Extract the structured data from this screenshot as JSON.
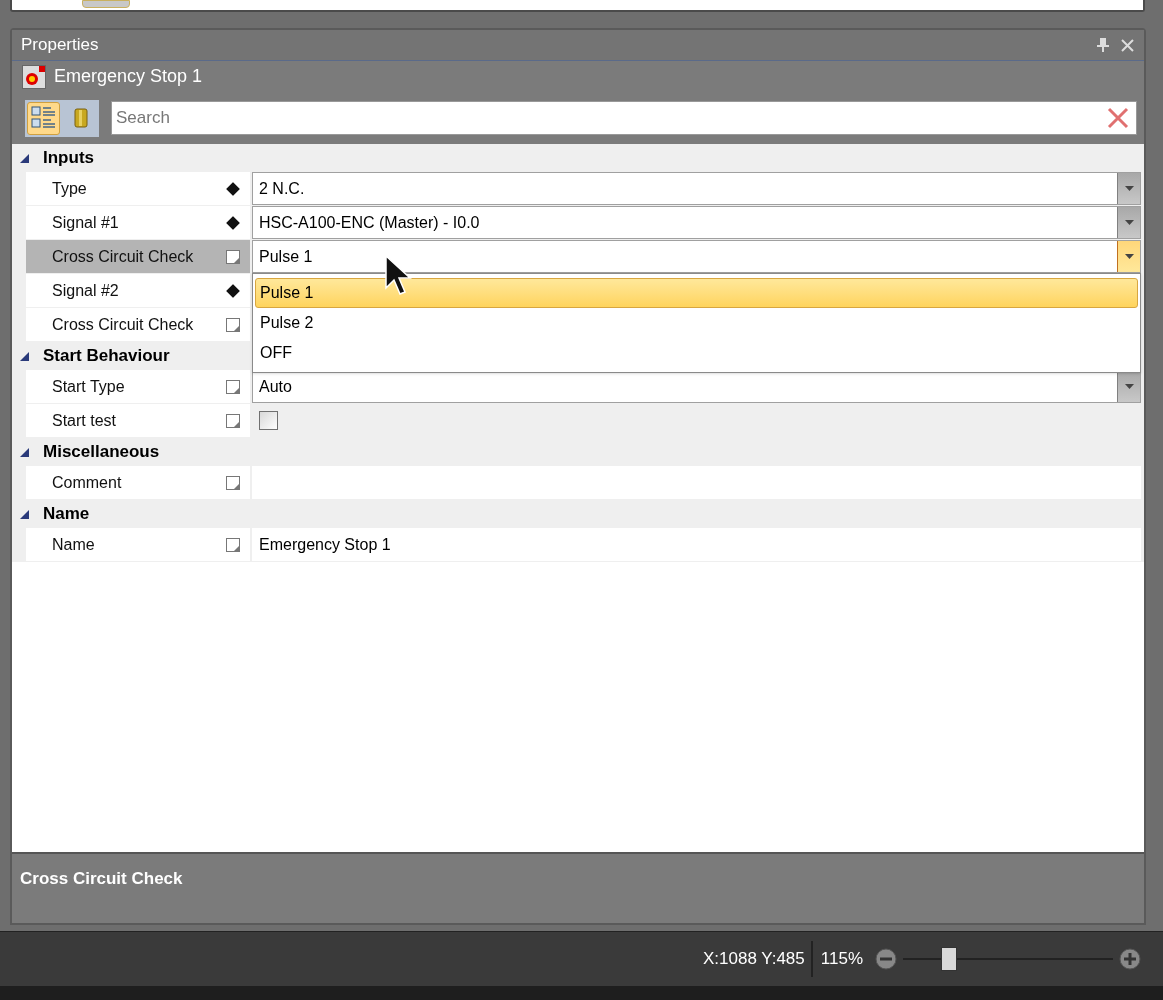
{
  "panel": {
    "title": "Properties"
  },
  "object": {
    "name": "Emergency Stop 1"
  },
  "view_buttons": [
    {
      "kind": "categorized",
      "selected": true
    },
    {
      "kind": "alphabetical",
      "selected": false
    }
  ],
  "search": {
    "placeholder": "Search"
  },
  "categories": [
    {
      "name": "Inputs",
      "expanded": true,
      "properties": [
        {
          "label": "Type",
          "linked": true,
          "kind": "dropdown",
          "value": "2 N.C.",
          "selected": false
        },
        {
          "label": "Signal #1",
          "linked": true,
          "kind": "dropdown",
          "value": "HSC-A100-ENC (Master) - I0.0",
          "selected": false
        },
        {
          "label": "Cross Circuit Check",
          "linked": false,
          "kind": "dropdown",
          "value": "Pulse 1",
          "selected": true,
          "open": true,
          "options": [
            {
              "label": "Pulse 1",
              "selected": true
            },
            {
              "label": "Pulse 2",
              "selected": false
            },
            {
              "label": "OFF",
              "selected": false
            }
          ]
        },
        {
          "label": "Signal #2",
          "linked": true,
          "kind": "hidden",
          "selected": false
        },
        {
          "label": "Cross Circuit Check",
          "linked": false,
          "kind": "hidden",
          "selected": false
        }
      ]
    },
    {
      "name": "Start Behaviour",
      "expanded": true,
      "properties": [
        {
          "label": "Start Type",
          "linked": false,
          "kind": "dropdown",
          "value": "Auto",
          "selected": false
        },
        {
          "label": "Start test",
          "linked": false,
          "kind": "checkbox",
          "checked": false,
          "selected": false
        }
      ]
    },
    {
      "name": "Miscellaneous",
      "expanded": true,
      "properties": [
        {
          "label": "Comment",
          "linked": false,
          "kind": "text",
          "selected": false
        }
      ]
    },
    {
      "name": "Name",
      "expanded": true,
      "properties": [
        {
          "label": "Name",
          "linked": false,
          "kind": "text",
          "value": "Emergency Stop 1",
          "selected": false
        }
      ]
    }
  ],
  "description": {
    "title": "Cross Circuit Check"
  },
  "status_bar": {
    "coordinates": "X:1088 Y:485",
    "zoom": "115%",
    "zoom_slider": {
      "level": 0.22
    }
  }
}
